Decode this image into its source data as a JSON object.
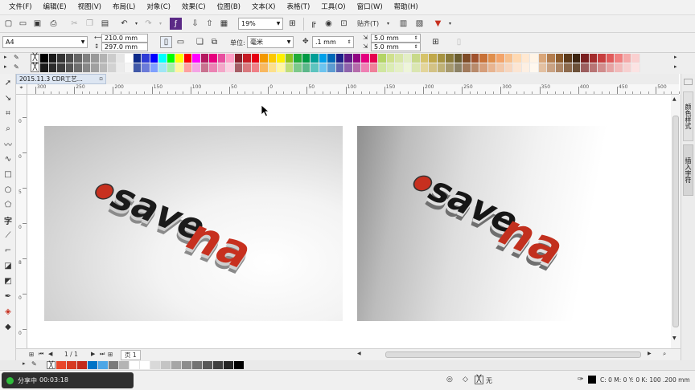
{
  "menu": [
    "文件(F)",
    "编辑(E)",
    "视图(V)",
    "布局(L)",
    "对象(C)",
    "效果(C)",
    "位图(B)",
    "文本(X)",
    "表格(T)",
    "工具(O)",
    "窗口(W)",
    "帮助(H)"
  ],
  "toolbar": {
    "zoom": "19%",
    "snap": "贴齐(T)"
  },
  "property_bar": {
    "page_size": "A4",
    "width": "210.0 mm",
    "height": "297.0 mm",
    "units_label": "单位:",
    "units": "毫米",
    "nudge": ".1 mm",
    "dup_x": "5.0 mm",
    "dup_y": "5.0 mm"
  },
  "document_tab": "2015.11.3 CDR工艺...",
  "ruler": {
    "ticks": [
      "300",
      "250",
      "200",
      "150",
      "100",
      "50",
      "0",
      "50",
      "100",
      "150",
      "200",
      "250",
      "300",
      "350",
      "400",
      "450",
      "500",
      "550",
      "600",
      "650",
      "700",
      "750",
      "800",
      "850",
      "900",
      "950",
      "1000",
      "1050",
      "1100",
      "1150",
      "1200",
      "1250"
    ],
    "vticks": [
      "0",
      "0",
      "5",
      "0",
      "8",
      "0",
      "0"
    ]
  },
  "pages": {
    "counter": "1 / 1",
    "page_tab": "页 1"
  },
  "artwork": {
    "logo_left": "savena",
    "logo_right": "savena"
  },
  "dockers": {
    "tab1": "颜色样式",
    "tab2": "插入字符"
  },
  "status": {
    "recording_label": "分享中",
    "recording_time": "00:03:18",
    "fill": "无",
    "outline": "C: 0 M: 0 Y: 0 K: 100  .200 mm"
  },
  "colors": {
    "palette_row1": [
      "#000000",
      "#1a1a1a",
      "#333333",
      "#4d4d4d",
      "#666666",
      "#808080",
      "#999999",
      "#b3b3b3",
      "#cccccc",
      "#e6e6e6",
      "#ffffff",
      "#0d2a8a",
      "#2e3cd6",
      "#0000ff",
      "#00ffff",
      "#00ff00",
      "#ffff00",
      "#ff0000",
      "#ff00ff",
      "#b4195f",
      "#e6007e",
      "#e84e9f",
      "#ff9ec6",
      "#8a1e2a",
      "#c61b24",
      "#e60012",
      "#f39800",
      "#fcc800",
      "#fff100",
      "#8fc31f",
      "#22ac38",
      "#009944",
      "#009e96",
      "#00a0e9",
      "#0068b7",
      "#1d2088",
      "#601986",
      "#920783",
      "#e4007f",
      "#e5004f",
      "#b3d465",
      "#cfe08d",
      "#d8e6a8",
      "#e3eec6",
      "#c8d98a",
      "#d6c36a",
      "#c0a84a",
      "#a69341",
      "#8a7a3a",
      "#6b5d2f",
      "#7e4b26",
      "#a0522d",
      "#c87137",
      "#e08f4c",
      "#f3a46a",
      "#f7c08e",
      "#ffd9b2",
      "#ffe8d1",
      "#fff4e6",
      "#d9a679",
      "#b37d4e",
      "#8c5a2b",
      "#5e3a1a",
      "#3d2410",
      "#7a1f1f",
      "#a32c2c",
      "#c73e3e",
      "#e05a5a",
      "#f08080",
      "#f5aaaa",
      "#fad0d0"
    ],
    "palette_row2": [
      "#1a1a1a",
      "#2b2b2b",
      "#3c3c3c",
      "#555555",
      "#6e6e6e",
      "#878787",
      "#a0a0a0",
      "#b9b9b9",
      "#d2d2d2",
      "#ebebeb",
      "#f5f5f5",
      "#4058a8",
      "#6b7bd9",
      "#7fa0ff",
      "#9fe6f5",
      "#a8f0a8",
      "#fff59f",
      "#ff9f9f",
      "#f5a3e6",
      "#c9728f",
      "#eb82b3",
      "#f4a6c8",
      "#fbd0e1",
      "#a65e66",
      "#d9787d",
      "#ef7f86",
      "#f8b860",
      "#fde08a",
      "#fff7a3",
      "#bfdd7a",
      "#7cc98a",
      "#5cb88a",
      "#5cc4bf",
      "#6cc4ef",
      "#5c9bd1",
      "#6466b0",
      "#8f63ac",
      "#b56bab",
      "#ef7fb3",
      "#f07f99",
      "#d0e6a0",
      "#dbecb3",
      "#e5f0c6",
      "#eef5da",
      "#dae6b1",
      "#e3d59a",
      "#d3c285",
      "#bfb176",
      "#a6996e",
      "#8c8266",
      "#a17a5c",
      "#b88a6b",
      "#d69e7a",
      "#e8b490",
      "#f2c7a8",
      "#f7d6be",
      "#fce5d2",
      "#fdefe2",
      "#fff8ef",
      "#e3c0a1",
      "#c9a283",
      "#ad8666",
      "#8c6a4d",
      "#6b5038",
      "#9c5e5e",
      "#b87474",
      "#d18c8c",
      "#e6a3a3",
      "#f2baba",
      "#f7d0d0",
      "#fce3e3"
    ],
    "doc_palette": [
      "#e8472b",
      "#d63a22",
      "#c32b1c",
      "#0073c6",
      "#4da6e6",
      "#7a7a7a",
      "#b4b4b4",
      "#ffffff",
      "#ffffff",
      "#d9d9d9",
      "#c4c4c4",
      "#a6a6a6",
      "#8c8c8c",
      "#737373",
      "#595959",
      "#404040",
      "#262626",
      "#000000"
    ],
    "accent_red": "#c7301f",
    "status_green": "#2fbd3b"
  }
}
